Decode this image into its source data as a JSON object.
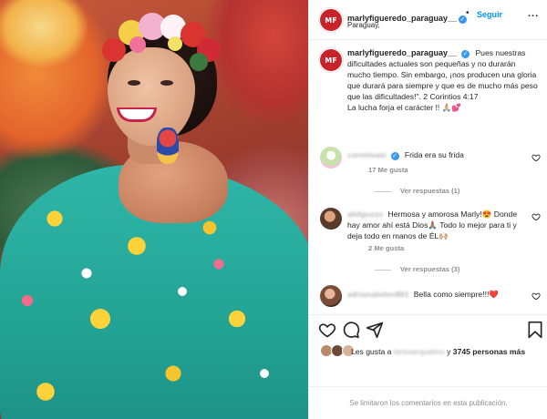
{
  "post": {
    "author": "marlyfigueredo_paraguay__",
    "avatar_initials": "MF",
    "follow_label": "Seguir",
    "separator": "•",
    "more_label": "...",
    "location": "Paraguay,",
    "caption": "Pues nuestras dificultades actuales son pequeñas y no durarán mucho tiempo. Sin embargo, ¡nos producen una gloria que durará para siempre y que es de mucho más peso que las dificultades!\". 2 Corintios 4:17",
    "caption_line2": "La lucha forja el carácter !! 🙏🏼💕"
  },
  "comments": [
    {
      "user": "carmimasi",
      "verified": true,
      "text": "Frida era su frida",
      "likes": "17 Me gusta",
      "replies": "Ver respuestas (1)"
    },
    {
      "user": "alidguzzo",
      "verified": false,
      "text": "Hermosa y amorosa Marly!😍 Donde hay amor ahí está Dios🙏🏽 Todo lo mejor para ti y deja todo en manos de ÉL🙌🏼",
      "likes": "2 Me gusta",
      "replies": "Ver respuestas (3)"
    },
    {
      "user": "adrianabelen881",
      "verified": false,
      "text": "Bella como siempre!!!❤️"
    }
  ],
  "likes": {
    "prefix": "Les gusta a",
    "liker": "larissarquelmo",
    "connector": "y",
    "count": "3745 personas más"
  },
  "footer": {
    "text": "Se limitaron los comentarios en esta publicación."
  },
  "icons": {
    "verified": "verified-badge-icon",
    "like": "heart-icon",
    "comment": "comment-bubble-icon",
    "share": "paper-plane-icon",
    "save": "bookmark-icon"
  },
  "colors": {
    "follow_blue": "#0095f6",
    "verified_blue": "#3897f0",
    "muted_gray": "#8e8e8e",
    "brand_avatar": "#c8232a"
  }
}
